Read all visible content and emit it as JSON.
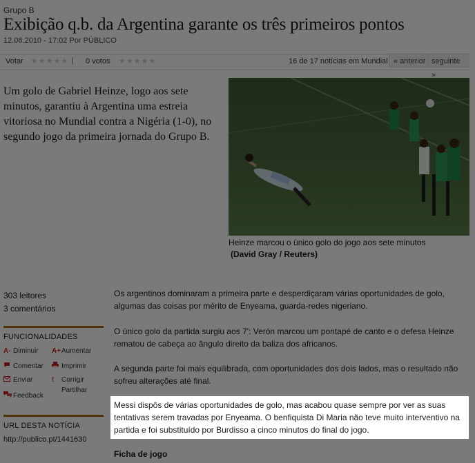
{
  "article": {
    "kicker": "Grupo B",
    "headline": "Exibição q.b. da Argentina garante os três primeiros pontos",
    "dateline": "12.06.2010 - 17:02 Por PÚBLICO",
    "lede": "Um golo de Gabriel Heinze, logo aos sete minutos, garantiu à Argentina uma estreia vitoriosa no Mundial contra a Nigéria (1-0), no segundo jogo da primeira jornada do Grupo B.",
    "caption": "Heinze marcou o único golo do jogo aos sete minutos",
    "credit": "(David Gray / Reuters)",
    "paragraphs": [
      "Os argentinos dominaram a primeira parte e desperdiçaram várias oportunidades de golo, algumas das coisas por mérito de Enyeama, guarda-redes nigeriano.",
      "O único golo da partida surgiu aos 7': Verón marcou um pontapé de canto e o defesa Heinze rematou de cabeça ao ângulo direito da baliza dos africanos.",
      "A segunda parte foi mais equilibrada, com oportunidades dos dois lados, mas o resultado não sofreu alterações até final.",
      "Messi dispôs de várias oportunidades de golo, mas acabou quase sempre por ver as suas tentativas serem travadas por Enyeama. O benfiquista Di Maria não teve muito interventivo na partida e foi substituído por Burdisso a cinco minutos do final do jogo."
    ],
    "ficha": "Ficha de jogo"
  },
  "votebar": {
    "vote_label": "Votar",
    "votes": "0 votos",
    "count": "16 de 17 notícias em Mundial",
    "prev": "« anterior",
    "next": "seguinte »"
  },
  "sidebar": {
    "readers": "303 leitores",
    "comments": "3 comentários",
    "func_title": "FUNCIONALIDADES",
    "tools": {
      "diminuir": "Diminuir",
      "aumentar": "Aumentar",
      "comentar": "Comentar",
      "imprimir": "Imprimir",
      "enviar": "Enviar",
      "corrigir": "Corrigir",
      "feedback": "Feedback",
      "partilhar": "Partilhar"
    },
    "icons": {
      "diminuir": "A-",
      "aumentar": "A+",
      "imprimir": "printer-icon",
      "comentar": "speech-bubble-icon",
      "enviar": "envelope-icon",
      "corrigir": "exclamation-icon",
      "feedback": "speech-bubbles-icon"
    },
    "url_title": "URL DESTA NOTÍCIA",
    "url": "http://publico.pt/1441630"
  },
  "colors": {
    "accent_rule": "#a86f1a",
    "icon_red": "#c62026",
    "dim_overlay": "rgba(0,0,0,0.52)",
    "highlight_bg": "#ffffff"
  }
}
